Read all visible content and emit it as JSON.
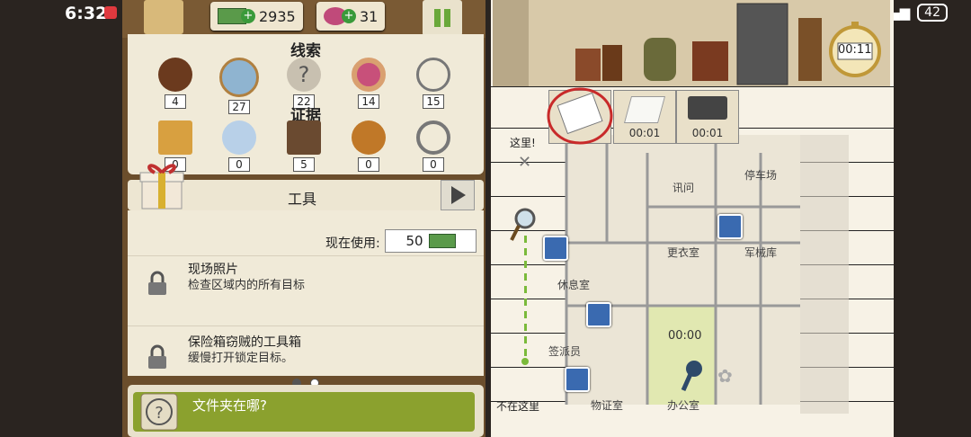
{
  "status": {
    "time": "6:32",
    "battery": "42"
  },
  "currency": {
    "cash": "2935",
    "gems": "31"
  },
  "clues": {
    "title": "线索",
    "items": [
      {
        "icon": "footprints-icon",
        "count": "4"
      },
      {
        "icon": "magnifier-icon",
        "count": "27"
      },
      {
        "icon": "question-icon",
        "count": "22"
      },
      {
        "icon": "donut-icon",
        "count": "14"
      },
      {
        "icon": "keys-icon",
        "count": "15"
      }
    ]
  },
  "evidence": {
    "title": "证据",
    "items": [
      {
        "icon": "map-icon",
        "count": "0"
      },
      {
        "icon": "fingerprint-icon",
        "count": "0"
      },
      {
        "icon": "photo-icon",
        "count": "5"
      },
      {
        "icon": "badge-icon",
        "count": "0"
      },
      {
        "icon": "brass-knuckles-icon",
        "count": "0"
      }
    ]
  },
  "tools": {
    "title": "工具",
    "now_using_label": "现在使用:",
    "cost": "50",
    "items": [
      {
        "name": "现场照片",
        "desc": "检查区域内的所有目标"
      },
      {
        "name": "保险箱窃贼的工具箱",
        "desc": "缓慢打开锁定目标。"
      }
    ]
  },
  "objective": {
    "text": "文件夹在哪?"
  },
  "map": {
    "timer": "00:11",
    "cards": [
      {
        "time": ""
      },
      {
        "time": "00:01"
      },
      {
        "time": "00:01"
      }
    ],
    "here_label": "这里!",
    "not_here_label": "不在这里",
    "rooms": {
      "parking": "停车场",
      "interrogation": "讯问",
      "locker": "更衣室",
      "armory": "军械库",
      "lounge": "休息室",
      "dispatcher": "签派员",
      "evidence": "物证室",
      "office": "办公室"
    },
    "office_timer": "00:00"
  }
}
